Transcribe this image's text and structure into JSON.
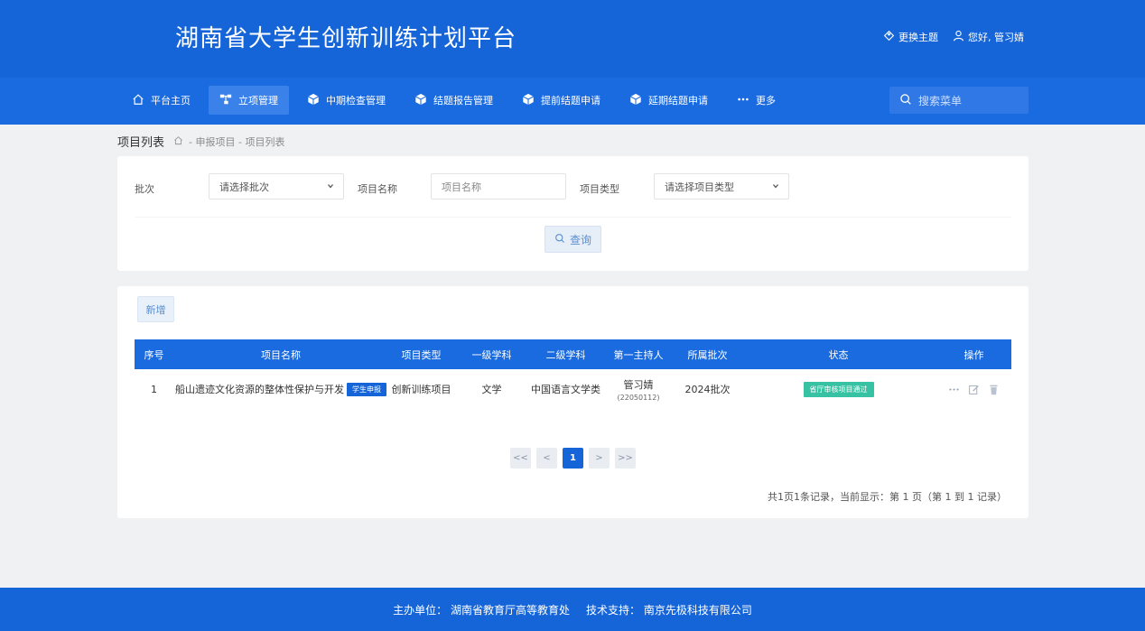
{
  "header": {
    "site_title": "湖南省大学生创新训练计划平台",
    "change_theme": "更换主题",
    "greeting": "您好, 管习婧"
  },
  "nav": {
    "items": [
      {
        "label": "平台主页",
        "icon": "home-icon",
        "active": false
      },
      {
        "label": "立项管理",
        "icon": "sitemap-icon",
        "active": true
      },
      {
        "label": "中期检查管理",
        "icon": "cube-icon",
        "active": false
      },
      {
        "label": "结题报告管理",
        "icon": "cube-icon",
        "active": false
      },
      {
        "label": "提前结题申请",
        "icon": "cube-icon",
        "active": false
      },
      {
        "label": "延期结题申请",
        "icon": "cube-icon",
        "active": false
      },
      {
        "label": "更多",
        "icon": "more-dots-icon",
        "active": false
      }
    ],
    "search_placeholder": "搜索菜单"
  },
  "breadcrumb": {
    "title": "项目列表",
    "path": "- 申报项目 - 项目列表"
  },
  "filters": {
    "batch_label": "批次",
    "batch_value": "请选择批次",
    "name_label": "项目名称",
    "name_placeholder": "项目名称",
    "type_label": "项目类型",
    "type_value": "请选择项目类型",
    "query_button": "查询"
  },
  "list": {
    "add_button": "新增",
    "columns": [
      "序号",
      "项目名称",
      "项目类型",
      "一级学科",
      "二级学科",
      "第一主持人",
      "所属批次",
      "状态",
      "操作"
    ],
    "rows": [
      {
        "index": "1",
        "name": "船山遗迹文化资源的整体性保护与开发",
        "tag": "学生申报",
        "type": "创新训练项目",
        "discipline1": "文学",
        "discipline2": "中国语言文学类",
        "host": "管习婧",
        "host_id": "(22050112)",
        "batch": "2024批次",
        "status": "省厅审核项目通过"
      }
    ],
    "pager": [
      "<<",
      "<",
      "1",
      ">",
      ">>"
    ],
    "current_page": "1",
    "record_info": "共1页1条记录，当前显示：第 1 页（第 1 到 1 记录）"
  },
  "footer": {
    "sponsor": "主办单位：  湖南省教育厅高等教育处",
    "support": "技术支持：  南京先极科技有限公司"
  },
  "colors": {
    "primary": "#1565d8",
    "nav_bg": "#1a6be0",
    "status_green": "#36c2a3",
    "page_bg": "#f0f1f3"
  }
}
